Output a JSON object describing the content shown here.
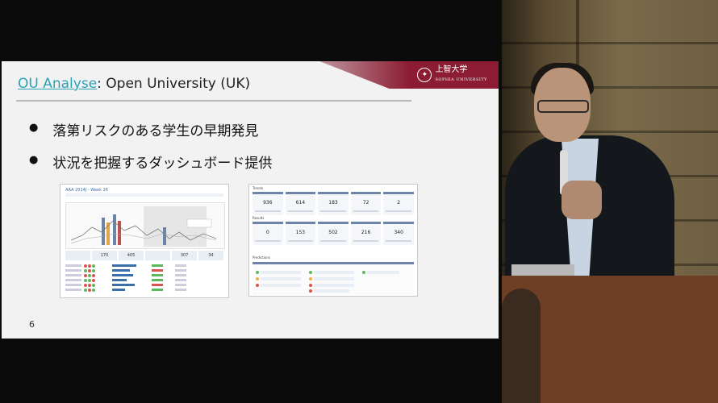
{
  "slide": {
    "title_link": "OU Analyse",
    "title_rest": ": Open University (UK)",
    "bullets": [
      "落第リスクのある学生の早期発見",
      "状況を把握するダッシュボード提供"
    ],
    "page_number": "6",
    "logo": {
      "name": "上智大学",
      "sub": "SOPHIA UNIVERSITY"
    }
  },
  "dashboard_left": {
    "header": "AAA 2014J - Week 26",
    "stats": [
      "",
      "170",
      "405",
      "",
      "307",
      "34"
    ]
  },
  "dashboard_right": {
    "section_trends": "Trends",
    "trend_values": [
      "936",
      "614",
      "183",
      "72",
      "2"
    ],
    "section_results": "Results",
    "result_values": [
      "0",
      "153",
      "502",
      "216",
      "340"
    ],
    "section_predictions": "Predictions"
  },
  "colors": {
    "accent_link": "#2aa2b8",
    "brand": "#8c1c33",
    "card_header": "#6b84a8"
  }
}
